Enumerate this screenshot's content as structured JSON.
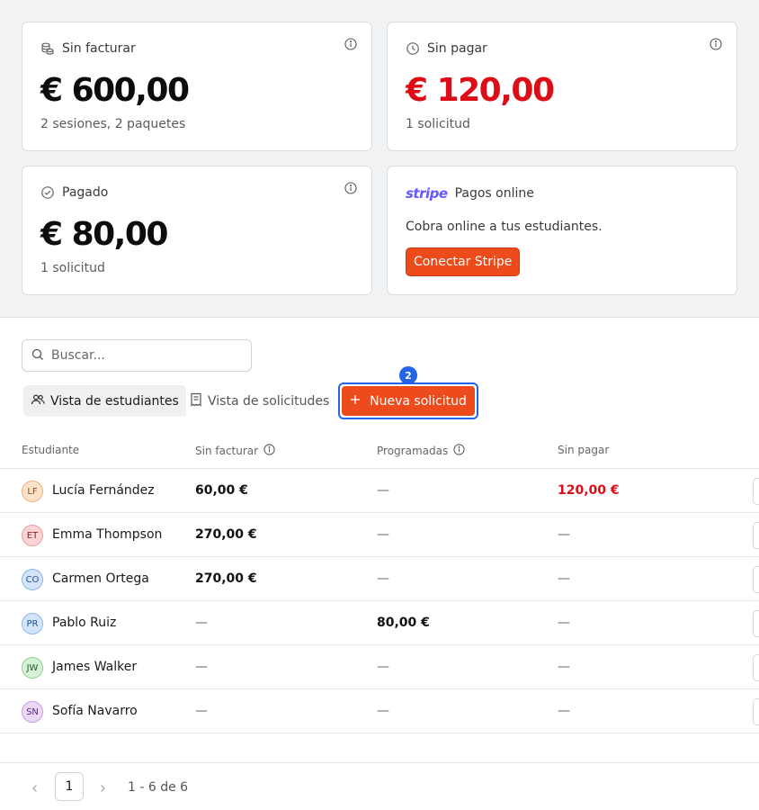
{
  "cards": {
    "unbilled": {
      "title": "Sin facturar",
      "amount": "€ 600,00",
      "sub": "2 sesiones, 2 paquetes"
    },
    "unpaid": {
      "title": "Sin pagar",
      "amount": "€ 120,00",
      "sub": "1 solicitud"
    },
    "paid": {
      "title": "Pagado",
      "amount": "€ 80,00",
      "sub": "1 solicitud"
    },
    "stripe": {
      "logo": "stripe",
      "title": "Pagos online",
      "desc": "Cobra online a tus estudiantes.",
      "button": "Conectar Stripe"
    }
  },
  "search": {
    "placeholder": "Buscar..."
  },
  "views": {
    "students": "Vista de estudiantes",
    "requests": "Vista de solicitudes"
  },
  "new_request": {
    "label": "Nueva solicitud",
    "badge": "2"
  },
  "table": {
    "headers": {
      "student": "Estudiante",
      "unbilled": "Sin facturar",
      "scheduled": "Programadas",
      "unpaid": "Sin pagar"
    },
    "rows": [
      {
        "initials": "LF",
        "name": "Lucía Fernández",
        "unbilled": "60,00 €",
        "scheduled": "—",
        "unpaid": "120,00 €"
      },
      {
        "initials": "ET",
        "name": "Emma Thompson",
        "unbilled": "270,00 €",
        "scheduled": "—",
        "unpaid": "—"
      },
      {
        "initials": "CO",
        "name": "Carmen Ortega",
        "unbilled": "270,00 €",
        "scheduled": "—",
        "unpaid": "—"
      },
      {
        "initials": "PR",
        "name": "Pablo Ruiz",
        "unbilled": "—",
        "scheduled": "80,00 €",
        "unpaid": "—"
      },
      {
        "initials": "JW",
        "name": "James Walker",
        "unbilled": "—",
        "scheduled": "—",
        "unpaid": "—"
      },
      {
        "initials": "SN",
        "name": "Sofía Navarro",
        "unbilled": "—",
        "scheduled": "—",
        "unpaid": "—"
      }
    ]
  },
  "pagination": {
    "page": "1",
    "info": "1 - 6 de 6"
  },
  "colors": {
    "accent": "#ed4b1c",
    "focus": "#2563eb",
    "negative": "#dc0d17",
    "stripe": "#635bff"
  }
}
